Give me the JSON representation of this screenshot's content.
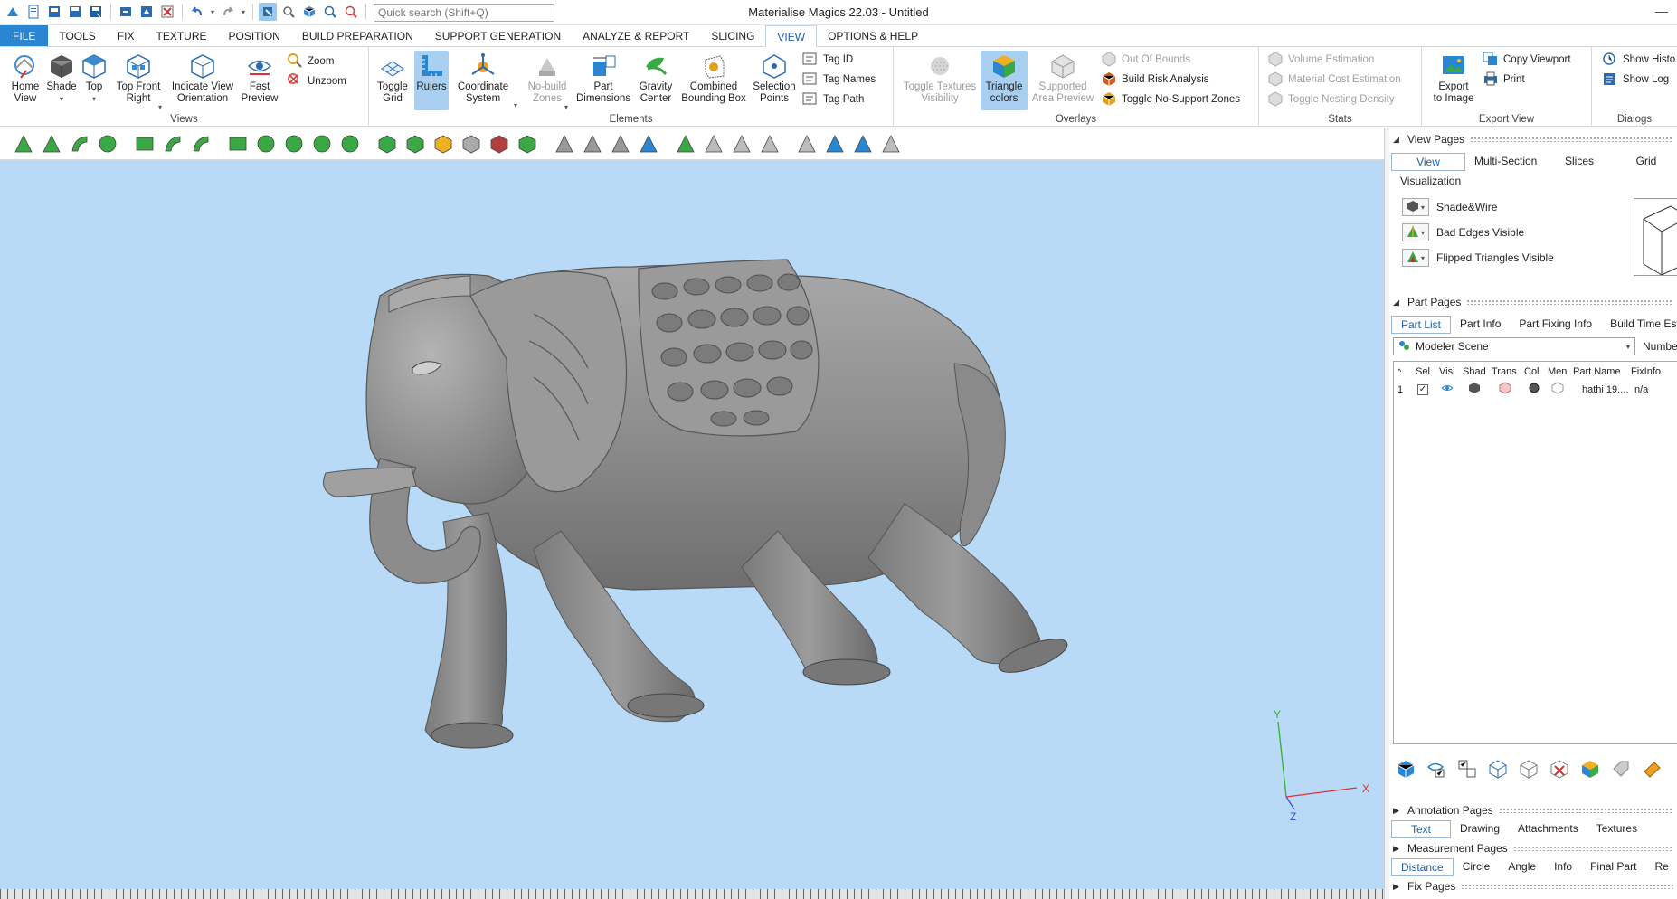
{
  "app_title": "Materialise Magics 22.03 - Untitled",
  "quick_search": {
    "placeholder": "Quick search (Shift+Q)"
  },
  "ribbon_tabs": [
    "FILE",
    "TOOLS",
    "FIX",
    "TEXTURE",
    "POSITION",
    "BUILD PREPARATION",
    "SUPPORT GENERATION",
    "ANALYZE & REPORT",
    "SLICING",
    "VIEW",
    "OPTIONS & HELP"
  ],
  "active_tab": "VIEW",
  "ribbon": {
    "views": {
      "label": "Views",
      "home": "Home\nView",
      "shade": "Shade",
      "top": "Top",
      "top_front_right": "Top Front\nRight",
      "indicate_view": "Indicate View\nOrientation",
      "fast_preview": "Fast\nPreview",
      "zoom": "Zoom",
      "unzoom": "Unzoom"
    },
    "elements": {
      "label": "Elements",
      "toggle_grid": "Toggle\nGrid",
      "rulers": "Rulers",
      "coordinate_system": "Coordinate\nSystem",
      "no_build_zones": "No-build\nZones",
      "part_dimensions": "Part\nDimensions",
      "gravity_center": "Gravity\nCenter",
      "combined_bbox": "Combined\nBounding Box",
      "selection_points": "Selection\nPoints",
      "tag_id": "Tag ID",
      "tag_names": "Tag Names",
      "tag_path": "Tag Path"
    },
    "overlays": {
      "label": "Overlays",
      "toggle_textures": "Toggle Textures\nVisibility",
      "triangle_colors": "Triangle\ncolors",
      "supported_area": "Supported\nArea Preview",
      "out_of_bounds": "Out Of Bounds",
      "build_risk": "Build Risk Analysis",
      "toggle_no_support": "Toggle No-Support Zones"
    },
    "stats": {
      "label": "Stats",
      "volume_estimation": "Volume Estimation",
      "material_cost": "Material Cost Estimation",
      "nesting_density": "Toggle Nesting Density"
    },
    "export_view": {
      "label": "Export View",
      "export_to_image": "Export\nto Image",
      "copy_viewport": "Copy Viewport",
      "print": "Print"
    },
    "dialogs": {
      "label": "Dialogs",
      "show_history": "Show Histo",
      "show_log": "Show Log"
    }
  },
  "viewport": {
    "axis_y": "Y",
    "axis_x": "X",
    "axis_z": "Z",
    "axis_colors": {
      "x": "#e03030",
      "y": "#30b030",
      "z": "#3050e0"
    }
  },
  "right_panel": {
    "view_pages": {
      "title": "View Pages",
      "tabs": [
        "View",
        "Multi-Section",
        "Slices",
        "Grid"
      ],
      "visualization_label": "Visualization",
      "options": [
        "Shade&Wire",
        "Bad Edges Visible",
        "Flipped Triangles Visible"
      ]
    },
    "part_pages": {
      "title": "Part Pages",
      "tabs": [
        "Part List",
        "Part Info",
        "Part Fixing Info",
        "Build Time Est"
      ],
      "scene": "Modeler Scene",
      "number_label": "Numbe",
      "columns": [
        "Sel",
        "Visi",
        "Shad",
        "Trans",
        "Col",
        "Men",
        "Part Name",
        "FixInfo"
      ],
      "rows": [
        {
          "index": "1",
          "part_name": "hathi 19....",
          "fixinfo": "n/a"
        }
      ]
    },
    "annotation_pages": {
      "title": "Annotation Pages",
      "tabs": [
        "Text",
        "Drawing",
        "Attachments",
        "Textures"
      ]
    },
    "measurement_pages": {
      "title": "Measurement Pages",
      "tabs": [
        "Distance",
        "Circle",
        "Angle",
        "Info",
        "Final Part",
        "Re"
      ]
    },
    "fix_pages": {
      "title": "Fix Pages"
    }
  }
}
